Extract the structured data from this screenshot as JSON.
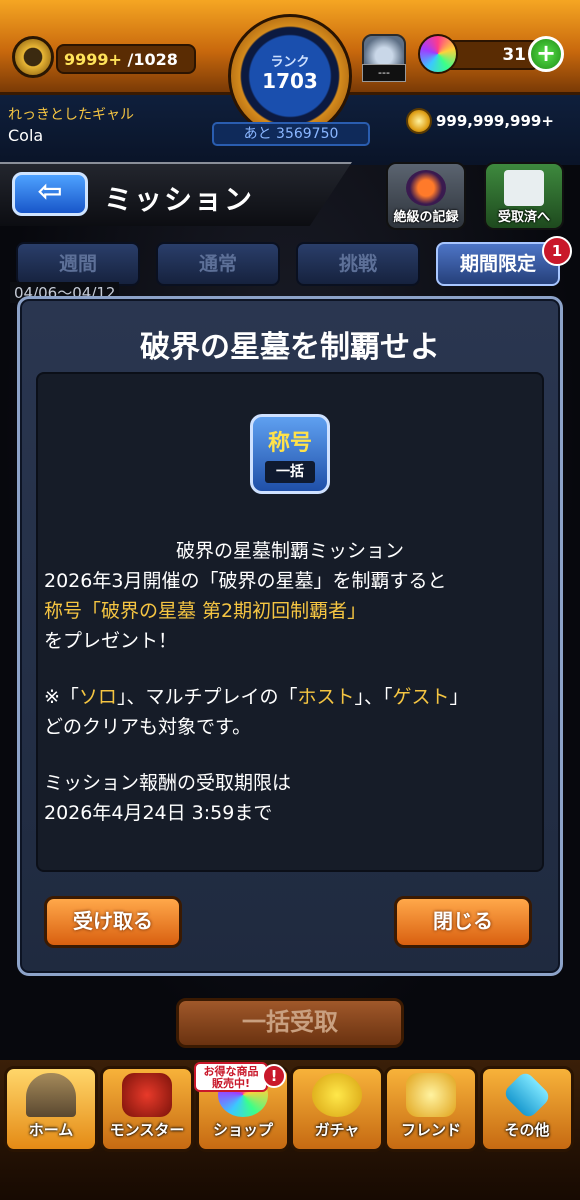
{
  "status": {
    "stamina_current": "9999+",
    "stamina_max": "/1028",
    "rank_label": "ランク",
    "rank_value": "1703",
    "exp_remaining_label": "あと",
    "exp_remaining_value": "3569750",
    "timer_display": "---",
    "orb_count": "31",
    "orb_plus": "+",
    "player_title": "れっきとしたギャル",
    "player_name": "Cola",
    "gold": "999,999,999+"
  },
  "header": {
    "back_arrow": "⇦",
    "title": "ミッション",
    "record_label": "絶級の記録",
    "received_label": "受取済へ"
  },
  "tabs": [
    {
      "label": "週間",
      "active": false
    },
    {
      "label": "通常",
      "active": false
    },
    {
      "label": "挑戦",
      "active": false
    },
    {
      "label": "期間限定",
      "active": true,
      "badge": "1"
    }
  ],
  "date_range": "04/06〜04/12",
  "modal": {
    "title": "破界の星墓を制覇せよ",
    "icon_top": "称号",
    "icon_bottom": "一括",
    "line1": "破界の星墓制覇ミッション",
    "line2": "2026年3月開催の「破界の星墓」を制覇すると",
    "line3": "称号「破界の星墓 第2期初回制覇者」",
    "line4": "をプレゼント！",
    "line5_pre": "※「",
    "line5_solo": "ソロ",
    "line5_mid1": "」、マルチプレイの「",
    "line5_host": "ホスト",
    "line5_mid2": "」、「",
    "line5_guest": "ゲスト",
    "line5_post": "」",
    "line6": "どのクリアも対象です。",
    "line7": "ミッション報酬の受取期限は",
    "line8": "2026年4月24日 3:59まで",
    "receive_button": "受け取る",
    "close_button": "閉じる"
  },
  "bulk_receive": "一括受取",
  "nav": {
    "home": "ホーム",
    "monster": "モンスター",
    "shop": "ショップ",
    "gacha": "ガチャ",
    "friend": "フレンド",
    "other": "その他",
    "shop_promo_line1": "お得な商品",
    "shop_promo_line2": "販売中!",
    "shop_alert": "!"
  },
  "colors": {
    "accent_orange": "#e48a15",
    "highlight_yellow": "#f5c542",
    "panel_blue": "#2a3650"
  }
}
